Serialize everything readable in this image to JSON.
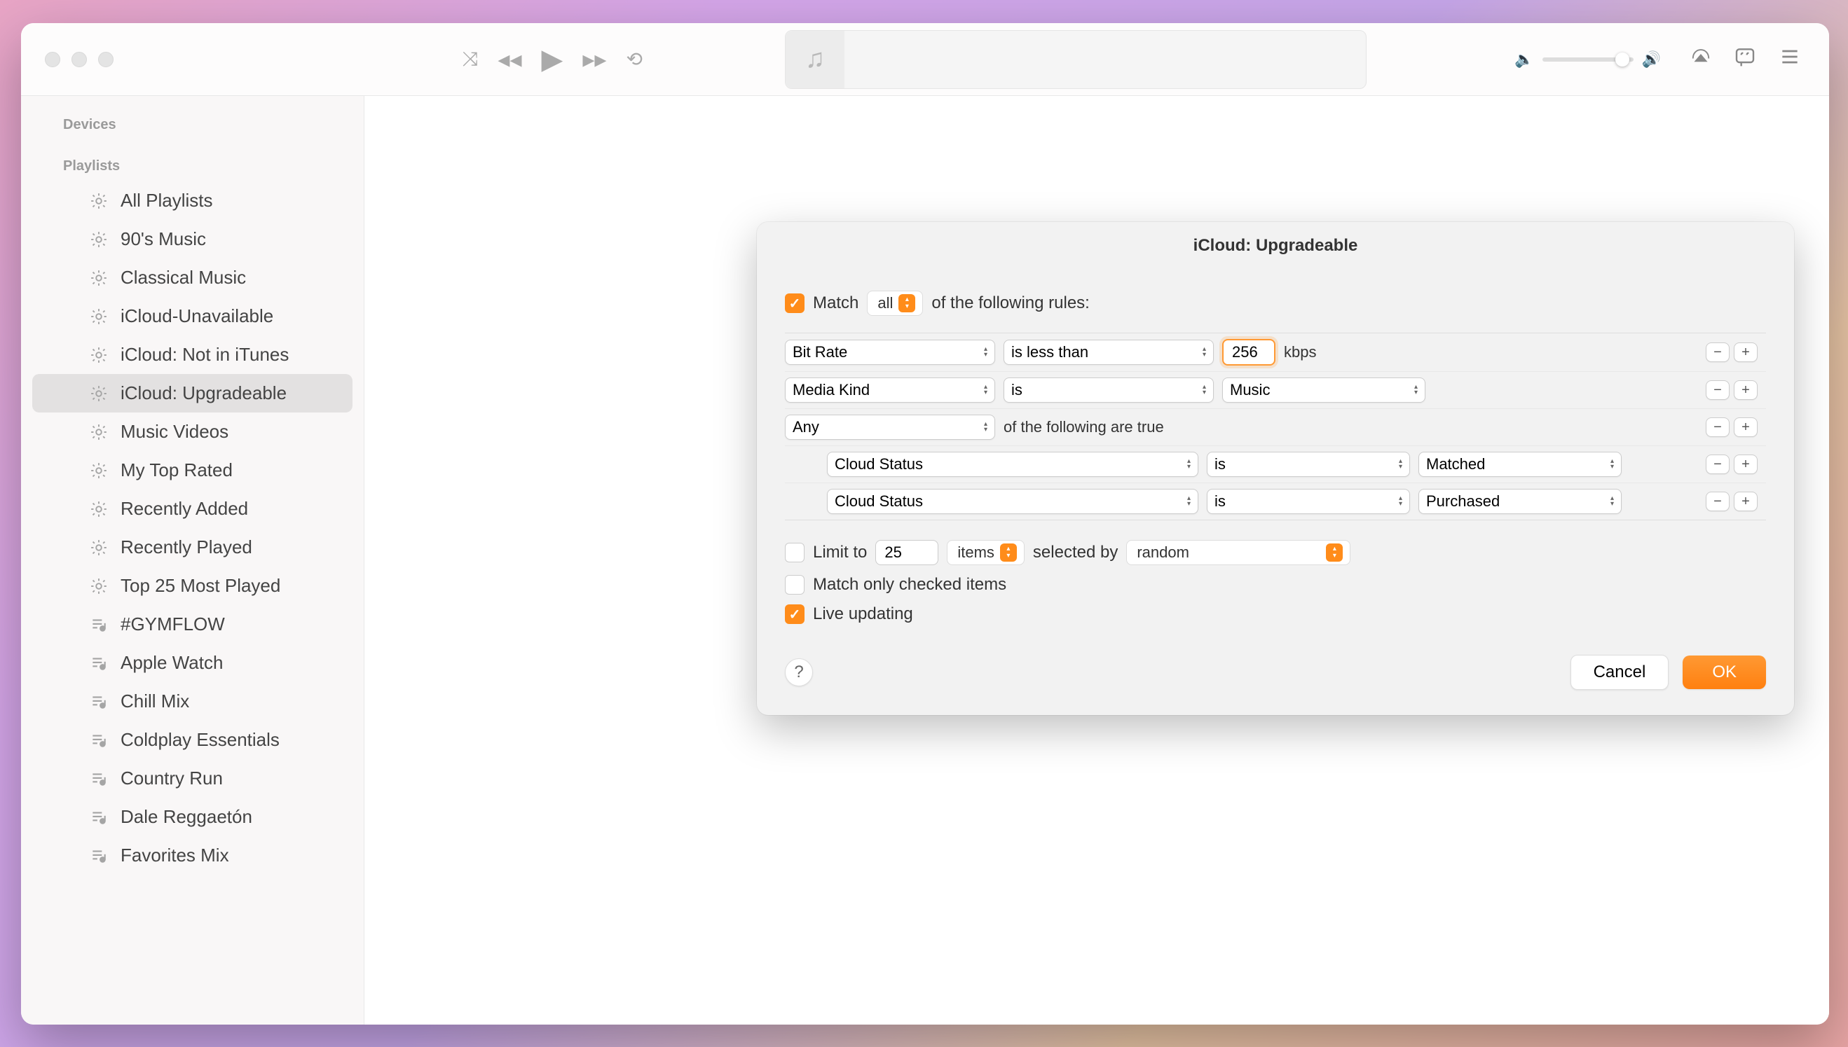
{
  "sidebar": {
    "devices_header": "Devices",
    "playlists_header": "Playlists",
    "items": [
      {
        "label": "All Playlists",
        "icon": "gear"
      },
      {
        "label": "90's Music",
        "icon": "gear"
      },
      {
        "label": "Classical Music",
        "icon": "gear"
      },
      {
        "label": "iCloud-Unavailable",
        "icon": "gear"
      },
      {
        "label": "iCloud: Not in iTunes",
        "icon": "gear"
      },
      {
        "label": "iCloud: Upgradeable",
        "icon": "gear",
        "selected": true
      },
      {
        "label": "Music Videos",
        "icon": "gear"
      },
      {
        "label": "My Top Rated",
        "icon": "gear"
      },
      {
        "label": "Recently Added",
        "icon": "gear"
      },
      {
        "label": "Recently Played",
        "icon": "gear"
      },
      {
        "label": "Top 25 Most Played",
        "icon": "gear"
      },
      {
        "label": "#GYMFLOW",
        "icon": "list"
      },
      {
        "label": "Apple Watch",
        "icon": "list"
      },
      {
        "label": "Chill Mix",
        "icon": "list"
      },
      {
        "label": "Coldplay Essentials",
        "icon": "list"
      },
      {
        "label": "Country Run",
        "icon": "list"
      },
      {
        "label": "Dale Reggaetón",
        "icon": "list"
      },
      {
        "label": "Favorites Mix",
        "icon": "list"
      }
    ]
  },
  "dialog": {
    "title": "iCloud: Upgradeable",
    "match_label": "Match",
    "match_mode": "all",
    "match_suffix": "of the following rules:",
    "rules": [
      {
        "field": "Bit Rate",
        "op": "is less than",
        "value": "256",
        "unit": "kbps"
      },
      {
        "field": "Media Kind",
        "op": "is",
        "value": "Music"
      },
      {
        "field": "Any",
        "suffix": "of the following are true"
      },
      {
        "field": "Cloud Status",
        "op": "is",
        "value": "Matched",
        "nested": true
      },
      {
        "field": "Cloud Status",
        "op": "is",
        "value": "Purchased",
        "nested": true
      }
    ],
    "limit": {
      "label": "Limit to",
      "value": "25",
      "unit": "items",
      "selected_by_label": "selected by",
      "selected_by": "random"
    },
    "match_only_label": "Match only checked items",
    "live_updating_label": "Live updating",
    "help": "?",
    "cancel": "Cancel",
    "ok": "OK"
  }
}
